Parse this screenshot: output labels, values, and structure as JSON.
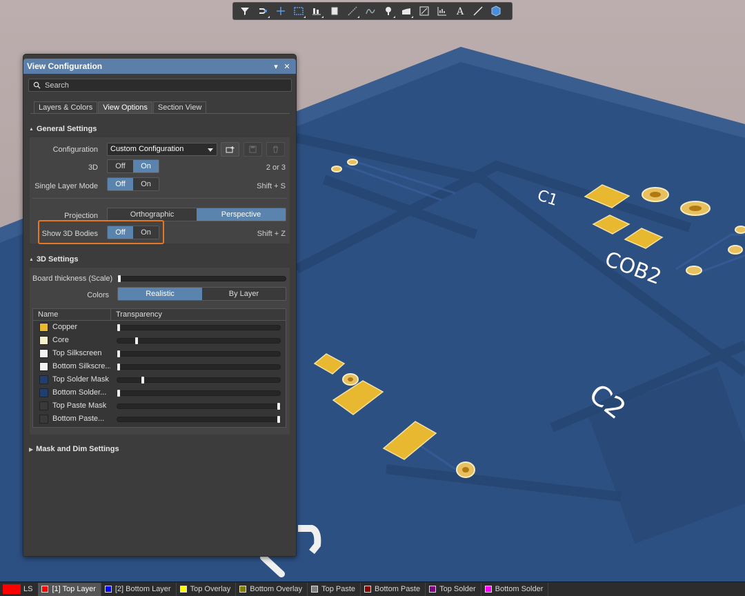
{
  "toolbar": {
    "icons": [
      "filter-icon",
      "route-icon",
      "cross-icon",
      "select-rect-icon",
      "align-icon",
      "component-icon",
      "interactive-route-icon",
      "arc-icon",
      "pad-icon",
      "fill-icon",
      "region-icon",
      "chart-icon",
      "text-icon",
      "line-icon",
      "3d-body-icon"
    ]
  },
  "panel": {
    "title": "View Configuration",
    "search_placeholder": "Search",
    "tabs": [
      "Layers & Colors",
      "View Options",
      "Section View"
    ],
    "active_tab": "View Options",
    "general": {
      "title": "General Settings",
      "configuration_label": "Configuration",
      "configuration_value": "Custom Configuration",
      "three_d_label": "3D",
      "three_d_off": "Off",
      "three_d_on": "On",
      "three_d_shortcut": "2 or 3",
      "single_layer_label": "Single Layer Mode",
      "single_layer_off": "Off",
      "single_layer_on": "On",
      "single_layer_shortcut": "Shift + S",
      "projection_label": "Projection",
      "projection_ortho": "Orthographic",
      "projection_persp": "Perspective",
      "bodies_label": "Show 3D Bodies",
      "bodies_off": "Off",
      "bodies_on": "On",
      "bodies_shortcut": "Shift + Z"
    },
    "settings3d": {
      "title": "3D Settings",
      "thickness_label": "Board thickness (Scale)",
      "thickness_value": 0.0,
      "colors_label": "Colors",
      "colors_realistic": "Realistic",
      "colors_by_layer": "By Layer",
      "table_headers": [
        "Name",
        "Transparency"
      ],
      "layers": [
        {
          "name": "Copper",
          "color": "#e8b830",
          "transparency": 0.0
        },
        {
          "name": "Core",
          "color": "#f5f0d0",
          "transparency": 0.11
        },
        {
          "name": "Top Silkscreen",
          "color": "#f2f2f2",
          "transparency": 0.0
        },
        {
          "name": "Bottom Silkscre...",
          "color": "#f2f2f2",
          "transparency": 0.0
        },
        {
          "name": "Top Solder Mask",
          "color": "#1f3f6e",
          "transparency": 0.15
        },
        {
          "name": "Bottom Solder...",
          "color": "#1f3f6e",
          "transparency": 0.0
        },
        {
          "name": "Top Paste Mask",
          "color": "#3a3a3a",
          "transparency": 1.0
        },
        {
          "name": "Bottom Paste...",
          "color": "#3a3a3a",
          "transparency": 1.0
        }
      ]
    },
    "mask_dim": {
      "title": "Mask and Dim Settings"
    }
  },
  "scene": {
    "labels": [
      "C1",
      "COB2",
      "C2"
    ],
    "board_color": "#2d5083",
    "pad_color": "#e8b830"
  },
  "statusbar": {
    "ls": "LS",
    "layers": [
      {
        "label": "[1] Top Layer",
        "color": "#ff0000",
        "active": true
      },
      {
        "label": "[2] Bottom Layer",
        "color": "#0000ff",
        "active": false
      },
      {
        "label": "Top Overlay",
        "color": "#ffff00",
        "active": false
      },
      {
        "label": "Bottom Overlay",
        "color": "#808000",
        "active": false
      },
      {
        "label": "Top Paste",
        "color": "#808080",
        "active": false
      },
      {
        "label": "Bottom Paste",
        "color": "#800000",
        "active": false
      },
      {
        "label": "Top Solder",
        "color": "#800080",
        "active": false
      },
      {
        "label": "Bottom Solder",
        "color": "#ff00ff",
        "active": false
      }
    ]
  }
}
